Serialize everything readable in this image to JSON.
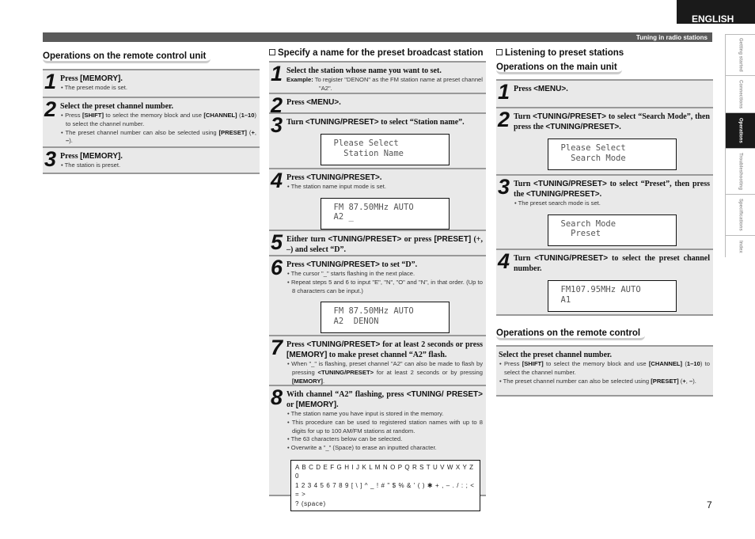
{
  "language": "ENGLISH",
  "header_title": "Tuning in radio stations",
  "side_tabs": [
    {
      "label": "Getting started"
    },
    {
      "label": "Connections"
    },
    {
      "label": "Operations",
      "active": true
    },
    {
      "label": "Troubleshooting"
    },
    {
      "label": "Specifications"
    },
    {
      "label": "Index"
    }
  ],
  "page_number": "7",
  "col1": {
    "subtitle": "Operations on the remote control unit",
    "steps": [
      {
        "num": "1",
        "head": [
          {
            "t": "Press "
          },
          {
            "t": "[MEMORY]",
            "b": 1
          },
          {
            "t": "."
          }
        ],
        "bullets": [
          [
            {
              "t": "The preset mode is set."
            }
          ]
        ]
      },
      {
        "num": "2",
        "head": [
          {
            "t": "Select the preset channel number."
          }
        ],
        "bullets": [
          [
            {
              "t": "Press "
            },
            {
              "t": "[SHIFT]",
              "b": 1
            },
            {
              "t": " to select the memory block and use "
            },
            {
              "t": "[CHANNEL]",
              "b": 1
            },
            {
              "t": " ("
            },
            {
              "t": "1–10",
              "b": 1
            },
            {
              "t": ") to select the channel number."
            }
          ],
          [
            {
              "t": "The preset channel number can also be selected using "
            },
            {
              "t": "[PRESET]",
              "b": 1
            },
            {
              "t": " ("
            },
            {
              "t": "+",
              "b": 1
            },
            {
              "t": ", "
            },
            {
              "t": "–",
              "b": 1
            },
            {
              "t": ")."
            }
          ]
        ]
      },
      {
        "num": "3",
        "head": [
          {
            "t": "Press "
          },
          {
            "t": "[MEMORY]",
            "b": 1
          },
          {
            "t": "."
          }
        ],
        "bullets": [
          [
            {
              "t": "The station is preset."
            }
          ]
        ]
      }
    ]
  },
  "col2": {
    "section": "Specify a name for the preset broadcast station",
    "steps": [
      {
        "num": "1",
        "head": [
          {
            "t": "Select the station whose name you want to set."
          }
        ],
        "example_label": "Example:",
        "example": "To register \"DENON\" as the FM station name at preset channel \"A2\"."
      },
      {
        "num": "2",
        "head": [
          {
            "t": "Press "
          },
          {
            "t": "<MENU>",
            "b": 1
          },
          {
            "t": "."
          }
        ]
      },
      {
        "num": "3",
        "head": [
          {
            "t": "Turn "
          },
          {
            "t": "<TUNING/PRESET>",
            "b": 1
          },
          {
            "t": " to select  “Station name”."
          }
        ],
        "lcd": [
          "Please Select",
          "  Station Name"
        ]
      },
      {
        "num": "4",
        "head": [
          {
            "t": "Press "
          },
          {
            "t": "<TUNING/PRESET>",
            "b": 1
          },
          {
            "t": "."
          }
        ],
        "bullets": [
          [
            {
              "t": "The station name input mode is set."
            }
          ]
        ],
        "lcd": [
          "FM 87.50MHz AUTO",
          "A2 _"
        ]
      },
      {
        "num": "5",
        "head": [
          {
            "t": "Either turn "
          },
          {
            "t": "<TUNING/PRESET>",
            "b": 1
          },
          {
            "t": " or press "
          },
          {
            "t": "[PRESET]",
            "b": 1
          },
          {
            "t": " (+, –) and select “D”."
          }
        ]
      },
      {
        "num": "6",
        "head": [
          {
            "t": "Press "
          },
          {
            "t": "<TUNING/PRESET>",
            "b": 1
          },
          {
            "t": " to set “D”."
          }
        ],
        "bullets": [
          [
            {
              "t": "The cursor \"_\" starts flashing in the next place."
            }
          ],
          [
            {
              "t": "Repeat steps 5 and 6 to input \"E\", \"N\", \"O\" and \"N\", in that order. (Up to 8 characters can be input.)"
            }
          ]
        ],
        "lcd": [
          "FM 87.50MHz AUTO",
          "A2  DENON"
        ]
      },
      {
        "num": "7",
        "head": [
          {
            "t": "Press "
          },
          {
            "t": "<TUNING/PRESET>",
            "b": 1
          },
          {
            "t": " for at least 2 seconds or press "
          },
          {
            "t": "[MEMORY]",
            "b": 1
          },
          {
            "t": " to make preset channel “A2” flash."
          }
        ],
        "bullets": [
          [
            {
              "t": "When \"_\" is flashing, preset channel \"A2\" can also be made to flash by pressing "
            },
            {
              "t": "<TUNING/PRESET>",
              "b": 1
            },
            {
              "t": " for at least 2 seconds or by pressing "
            },
            {
              "t": "[MEMORY]",
              "b": 1
            },
            {
              "t": "."
            }
          ]
        ]
      },
      {
        "num": "8",
        "head": [
          {
            "t": "With channel “A2” flashing, press "
          },
          {
            "t": "<TUNING/ PRESET>",
            "b": 1
          },
          {
            "t": " or "
          },
          {
            "t": "[MEMORY]",
            "b": 1
          },
          {
            "t": "."
          }
        ],
        "bullets": [
          [
            {
              "t": "The station name you have input is stored in the memory."
            }
          ],
          [
            {
              "t": "This procedure can be used to registered station names with up to 8 digits for up to 100 AM/FM stations at random."
            }
          ],
          [
            {
              "t": "The 63 characters below can be selected."
            }
          ],
          [
            {
              "t": "Overwrite a \"_\" (Space) to erase an inputted character."
            }
          ]
        ],
        "chars": [
          "A B C D E F G H I J K L M N O P Q R S T U V W X Y Z 0",
          "1 2 3 4 5 6 7 8 9 [ \\ ] ^ _ ! # \" $ % & ' ( ) ✱ + , – . / : ; < = >",
          "? (space)"
        ]
      }
    ]
  },
  "col3": {
    "section": "Listening to preset stations",
    "subtitle": "Operations on the main unit",
    "steps": [
      {
        "num": "1",
        "head": [
          {
            "t": "Press "
          },
          {
            "t": "<MENU>",
            "b": 1
          },
          {
            "t": "."
          }
        ]
      },
      {
        "num": "2",
        "head": [
          {
            "t": "Turn "
          },
          {
            "t": "<TUNING/PRESET>",
            "b": 1
          },
          {
            "t": " to select “Search Mode”, then press the "
          },
          {
            "t": "<TUNING/PRESET>",
            "b": 1
          },
          {
            "t": "."
          }
        ],
        "lcd": [
          "Please Select",
          "  Search Mode"
        ]
      },
      {
        "num": "3",
        "head": [
          {
            "t": "Turn "
          },
          {
            "t": "<TUNING/PRESET>",
            "b": 1
          },
          {
            "t": " to select “Preset”, then press the "
          },
          {
            "t": "<TUNING/PRESET>",
            "b": 1
          },
          {
            "t": "."
          }
        ],
        "bullets": [
          [
            {
              "t": "The preset search mode is set."
            }
          ]
        ],
        "lcd": [
          "Search Mode",
          "  Preset"
        ]
      },
      {
        "num": "4",
        "head": [
          {
            "t": "Turn "
          },
          {
            "t": "<TUNING/PRESET>",
            "b": 1
          },
          {
            "t": " to select the preset channel number."
          }
        ],
        "lcd": [
          "FM107.95MHz AUTO",
          "A1"
        ]
      }
    ],
    "remote_subtitle": "Operations on the remote control",
    "remote": {
      "head": [
        {
          "t": "Select the preset channel number."
        }
      ],
      "bullets": [
        [
          {
            "t": "Press "
          },
          {
            "t": "[SHIFT]",
            "b": 1
          },
          {
            "t": " to select the memory block and use "
          },
          {
            "t": "[CHANNEL]",
            "b": 1
          },
          {
            "t": " ("
          },
          {
            "t": "1–10",
            "b": 1
          },
          {
            "t": ") to select the channel number."
          }
        ],
        [
          {
            "t": "The preset channel number can also be selected using "
          },
          {
            "t": "[PRESET]",
            "b": 1
          },
          {
            "t": " ("
          },
          {
            "t": "+",
            "b": 1
          },
          {
            "t": ", "
          },
          {
            "t": "–",
            "b": 1
          },
          {
            "t": ")."
          }
        ]
      ]
    }
  }
}
